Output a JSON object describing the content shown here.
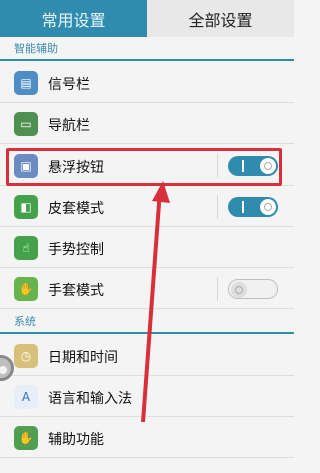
{
  "tabs": [
    {
      "label": "常用设置",
      "active": false
    },
    {
      "label": "全部设置",
      "active": true
    }
  ],
  "sections": {
    "smart": "智能辅助",
    "system": "系统"
  },
  "rows": [
    {
      "label": "信号栏",
      "icon": "signal-bar-icon"
    },
    {
      "label": "导航栏",
      "icon": "navigation-bar-icon"
    },
    {
      "label": "悬浮按钮",
      "icon": "floating-button-icon",
      "toggle": "on",
      "highlighted": true
    },
    {
      "label": "皮套模式",
      "icon": "cover-mode-icon",
      "toggle": "on"
    },
    {
      "label": "手势控制",
      "icon": "gesture-icon"
    },
    {
      "label": "手套模式",
      "icon": "glove-mode-icon",
      "toggle": "off"
    },
    {
      "label": "日期和时间",
      "icon": "clock-icon"
    },
    {
      "label": "语言和输入法",
      "icon": "language-icon"
    },
    {
      "label": "辅助功能",
      "icon": "accessibility-icon"
    }
  ],
  "colors": {
    "accent": "#2f8cae",
    "highlight": "#d8303a"
  }
}
